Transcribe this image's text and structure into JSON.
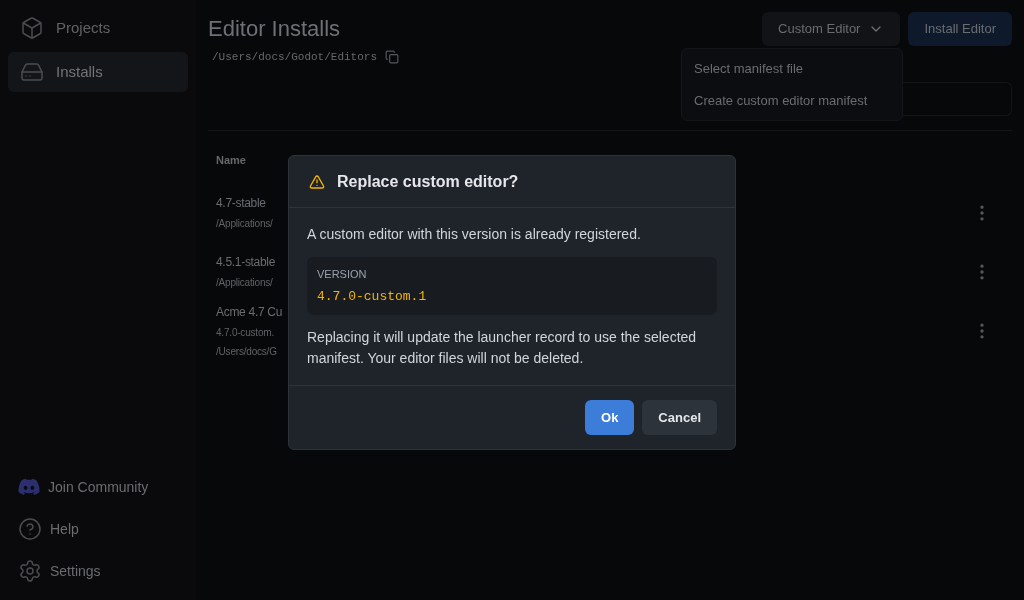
{
  "sidebar": {
    "items": [
      {
        "label": "Projects",
        "selected": false
      },
      {
        "label": "Installs",
        "selected": true
      }
    ],
    "footer_items": [
      {
        "label": "Join Community"
      },
      {
        "label": "Help"
      },
      {
        "label": "Settings"
      }
    ]
  },
  "page": {
    "title": "Editor Installs",
    "path": "/Users/docs/Godot/Editors",
    "buttons": [
      {
        "label": "Custom Editor",
        "kind": "dropdown"
      },
      {
        "label": "Install Editor",
        "kind": "primary"
      }
    ],
    "menu": [
      "Select manifest file",
      "Create custom editor manifest"
    ],
    "table": {
      "columns": [
        "Name"
      ],
      "rows": [
        {
          "name": "4.7-stable",
          "details": [
            "/Applications/"
          ]
        },
        {
          "name": "4.5.1-stable",
          "details": [
            "/Applications/"
          ]
        },
        {
          "name": "Acme 4.7 Cu",
          "details": [
            "4.7.0-custom.",
            "/Users/docs/G"
          ]
        }
      ]
    }
  },
  "dialog": {
    "title": "Replace custom editor?",
    "message": "A custom editor with this version is already registered.",
    "field_label": "VERSION",
    "field_value": "4.7.0-custom.1",
    "note": "Replacing it will update the launcher record to use the selected manifest. Your editor files will not be deleted.",
    "buttons": [
      {
        "label": "Ok",
        "kind": "primary"
      },
      {
        "label": "Cancel",
        "kind": "secondary"
      }
    ]
  }
}
